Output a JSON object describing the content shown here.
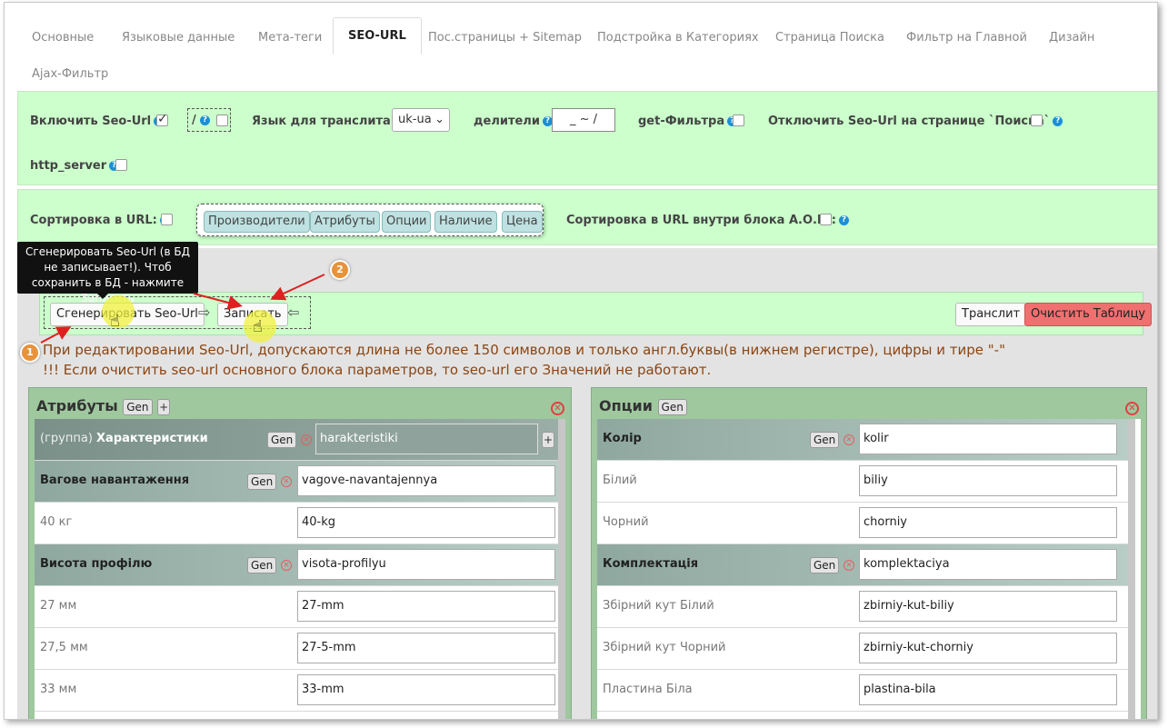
{
  "tabs": [
    "Основные",
    "Языковые данные",
    "Мета-теги",
    "SEO-URL",
    "Пос.страницы + Sitemap",
    "Подстройка в Категориях",
    "Страница Поиска",
    "Фильтр на Главной",
    "Дизайн",
    "Ajax-Фильтр"
  ],
  "active_tab": "SEO-URL",
  "settings": {
    "enable_seo": "Включить Seo-Url",
    "slash": "/",
    "translit_lang": "Язык для транслита",
    "translit_value": "uk-ua",
    "dividers": "делители",
    "dividers_value": "_ ~ /",
    "get_filter": "get-Фильтра",
    "disable_search": "Отключить Seo-Url на странице `Поиска`",
    "http_server": "http_server",
    "sort_url": "Сортировка в URL:",
    "sort_items": [
      "Производители",
      "Атрибуты",
      "Опции",
      "Наличие",
      "Цена"
    ],
    "sort_inside": "Сортировка в URL внутри блока А.О.П.:"
  },
  "tooltip": "Сгенерировать Seo-Url (в БД не записывает!). Чтоб сохранить в БД - нажмите Записать",
  "toolbar": {
    "generate": "Сгенерировать Seo-Url",
    "write": "Записать",
    "translit": "Транслит",
    "clear": "Очистить Таблицу"
  },
  "notes": [
    "При редактировании Seo-Url, допускаются длина не более 150 символов и только англ.буквы(в нижнем регистре), цифры и тире \"-\"",
    "!!! Если очистить seo-url основного блока параметров, то seo-url его Значений не работают."
  ],
  "badges": [
    "1",
    "2"
  ],
  "attributes": {
    "title": "Атрибуты",
    "gen": "Gen",
    "plus": "+",
    "group_prefix": "(группа)",
    "group_name": "Характеристики",
    "group_value": "harakteristiki",
    "rows": [
      {
        "label": "Вагове навантаження",
        "value": "vagove-navantajennya",
        "header": true
      },
      {
        "label": "40 кг",
        "value": "40-kg",
        "header": false
      },
      {
        "label": "Висота профілю",
        "value": "visota-profilyu",
        "header": true
      },
      {
        "label": "27 мм",
        "value": "27-mm",
        "header": false
      },
      {
        "label": "27,5 мм",
        "value": "27-5-mm",
        "header": false
      },
      {
        "label": "33 мм",
        "value": "33-mm",
        "header": false
      }
    ]
  },
  "options": {
    "title": "Опции",
    "gen": "Gen",
    "rows": [
      {
        "label": "Колір",
        "value": "kolir",
        "header": true
      },
      {
        "label": "Білий",
        "value": "biliy",
        "header": false
      },
      {
        "label": "Чорний",
        "value": "chorniy",
        "header": false
      },
      {
        "label": "Комплектація",
        "value": "komplektaciya",
        "header": true
      },
      {
        "label": "Збірний кут Білий",
        "value": "zbirniy-kut-biliy",
        "header": false
      },
      {
        "label": "Збірний кут Чорний",
        "value": "zbirniy-kut-chorniy",
        "header": false
      },
      {
        "label": "Пластина Біла",
        "value": "plastina-bila",
        "header": false
      }
    ]
  }
}
